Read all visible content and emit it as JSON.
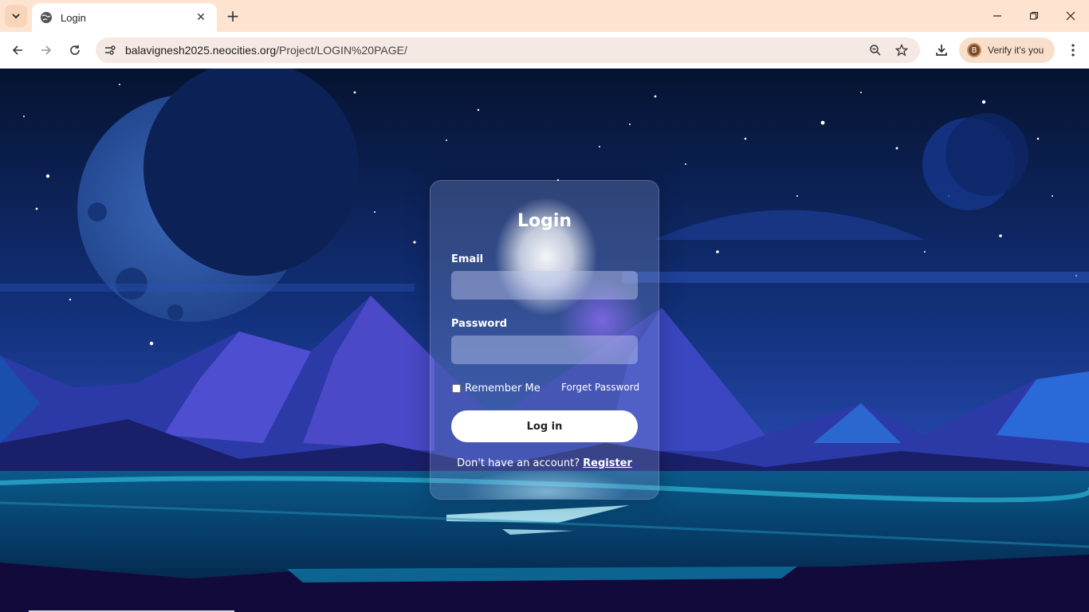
{
  "browser": {
    "tab_title": "Login",
    "url_host": "balavignesh2025.neocities.org",
    "url_path": "/Project/LOGIN%20PAGE/",
    "verify_label": "Verify it's you",
    "verify_avatar_letter": "B",
    "new_tab_symbol": "+",
    "close_symbol": "✕"
  },
  "login": {
    "title": "Login",
    "email_label": "Email",
    "email_value": "",
    "password_label": "Password",
    "password_value": "",
    "remember_label": "Remember Me",
    "remember_checked": false,
    "forget_label": "Forget Password",
    "submit_label": "Log in",
    "no_account_text": "Don't have an account?",
    "register_label": "Register"
  },
  "colors": {
    "titlebar": "#fde3d0",
    "sky_top": "#071634",
    "sky_bottom": "#1c3a8a",
    "accent_button": "#ffffff"
  }
}
